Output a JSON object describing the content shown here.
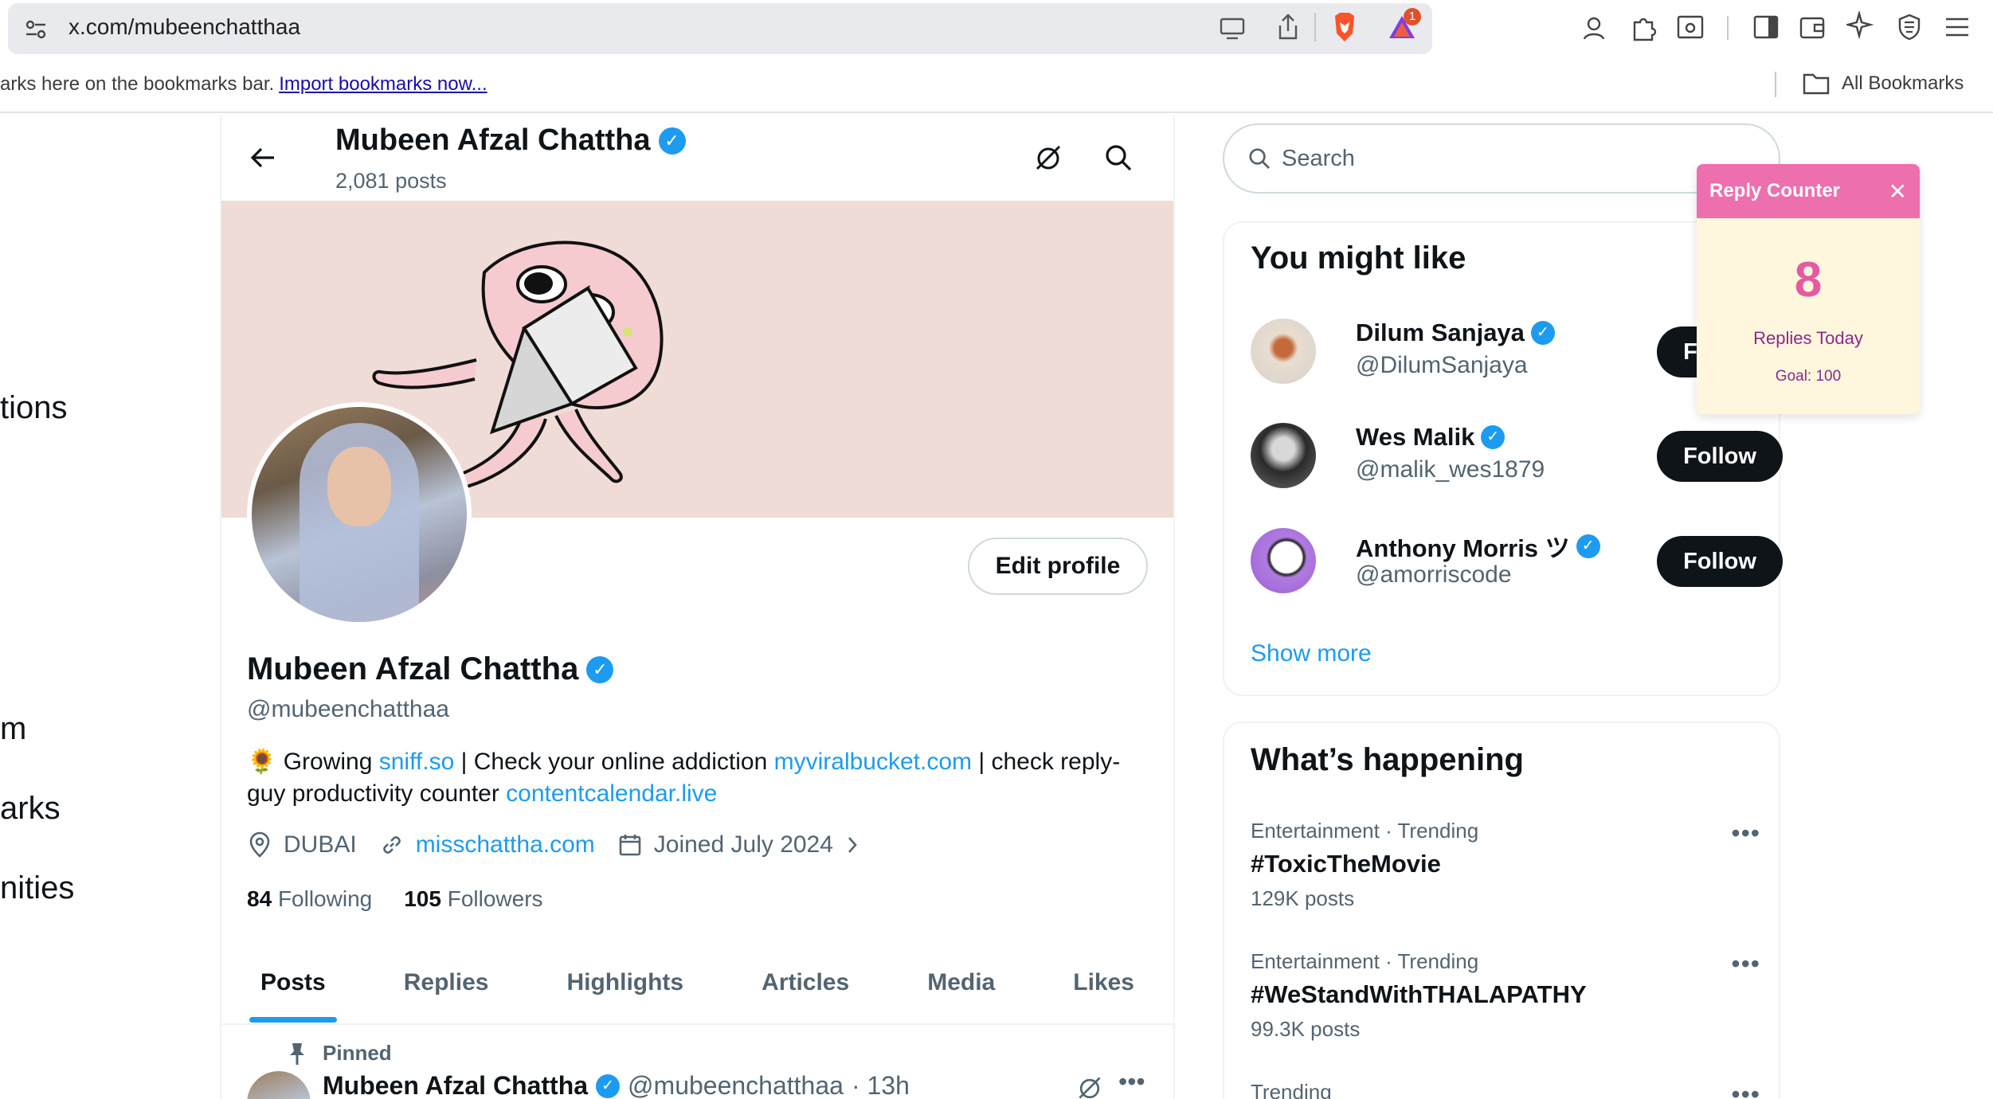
{
  "browser": {
    "url": "x.com/mubeenchatthaa",
    "bookmarks_text": "arks here on the bookmarks bar.",
    "import_link": "Import bookmarks now...",
    "all_bookmarks": "All Bookmarks",
    "notification_badge": "1"
  },
  "left_nav": [
    "tions",
    "m",
    "arks",
    "nities"
  ],
  "header": {
    "name": "Mubeen Afzal Chattha",
    "posts_count": "2,081 posts"
  },
  "profile": {
    "edit_button": "Edit profile",
    "name": "Mubeen Afzal Chattha",
    "handle": "@mubeenchatthaa",
    "bio": {
      "emoji": "🌻",
      "t1": " Growing ",
      "link1": "sniff.so",
      "t2": " | Check your online addiction ",
      "link2": "myviralbucket.com",
      "t3": " | check reply-guy productivity counter ",
      "link3": "contentcalendar.live"
    },
    "location": "DUBAI",
    "website": "misschattha.com",
    "joined": "Joined July 2024",
    "following_count": "84",
    "following_label": "Following",
    "followers_count": "105",
    "followers_label": "Followers"
  },
  "tabs": [
    "Posts",
    "Replies",
    "Highlights",
    "Articles",
    "Media",
    "Likes"
  ],
  "pinned_post": {
    "pinned_label": "Pinned",
    "author": "Mubeen Afzal Chattha",
    "handle": "@mubeenchatthaa",
    "time": "· 13h"
  },
  "search": {
    "placeholder": "Search"
  },
  "who_to_follow": {
    "title": "You might like",
    "users": [
      {
        "name": "Dilum Sanjaya",
        "handle": "@DilumSanjaya",
        "button": "Follow"
      },
      {
        "name": "Wes Malik",
        "handle": "@malik_wes1879",
        "button": "Follow"
      },
      {
        "name": "Anthony Morris ツ",
        "handle": "@amorriscode",
        "button": "Follow"
      }
    ],
    "show_more": "Show more"
  },
  "trends": {
    "title": "What’s happening",
    "items": [
      {
        "category": "Entertainment · Trending",
        "tag": "#ToxicTheMovie",
        "count": "129K posts"
      },
      {
        "category": "Entertainment · Trending",
        "tag": "#WeStandWithTHALAPATHY",
        "count": "99.3K posts"
      },
      {
        "category": "Trending",
        "tag": "",
        "count": ""
      }
    ]
  },
  "reply_counter": {
    "title": "Reply Counter",
    "count": "8",
    "label": "Replies Today",
    "goal": "Goal: 100"
  },
  "colors": {
    "accent": "#1d9bf0",
    "counter_pink": "#ee6fad",
    "counter_bg": "#fef6dd"
  }
}
